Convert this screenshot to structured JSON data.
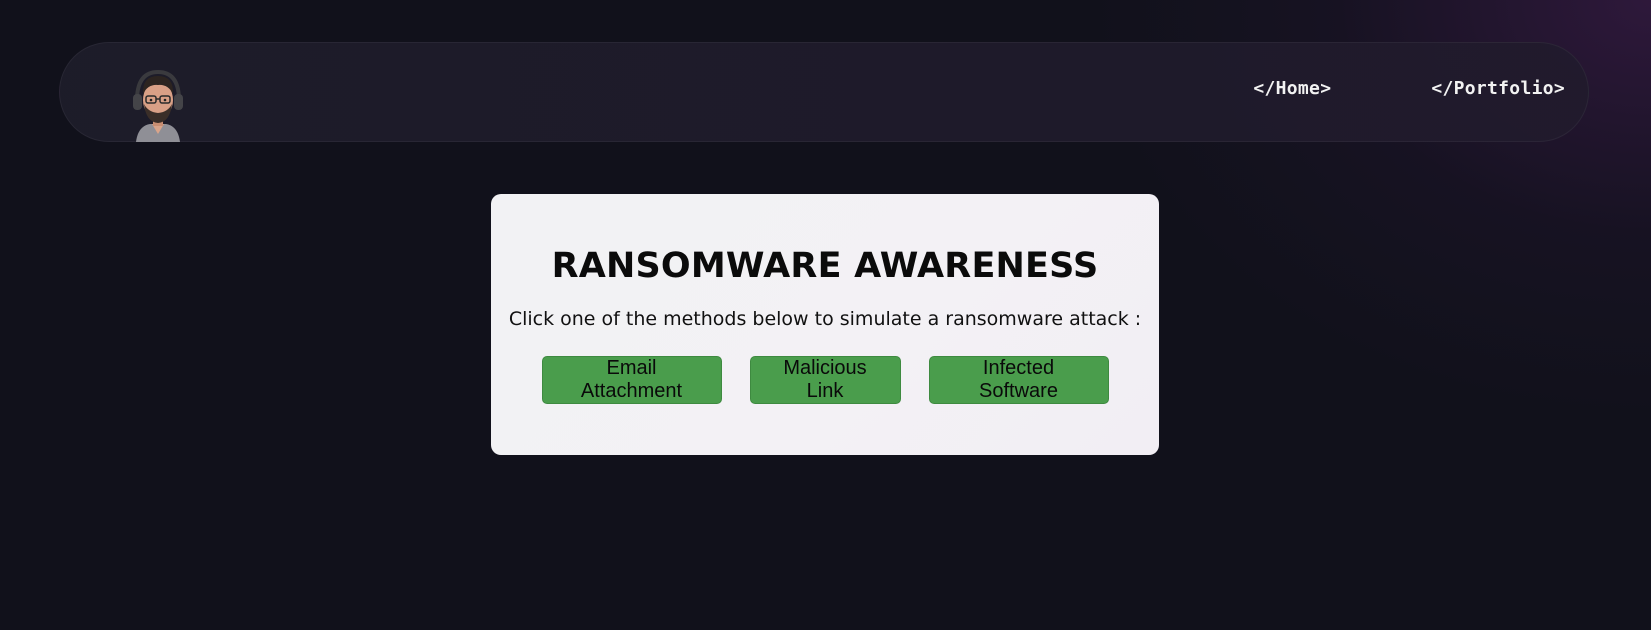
{
  "nav": {
    "avatar_icon": "developer-avatar-icon",
    "links": [
      {
        "label": "</Home>"
      },
      {
        "label": "</Portfolio>"
      }
    ]
  },
  "card": {
    "title": "RANSOMWARE AWARENESS",
    "subtitle": "Click one of the methods below to simulate a ransomware attack :",
    "buttons": [
      {
        "label": "Email Attachment"
      },
      {
        "label": "Malicious Link"
      },
      {
        "label": "Infected Software"
      }
    ]
  },
  "colors": {
    "background": "#11111b",
    "card": "#f2f2f4",
    "button": "#4a9d4c",
    "nav_text": "#f2f2f2"
  }
}
